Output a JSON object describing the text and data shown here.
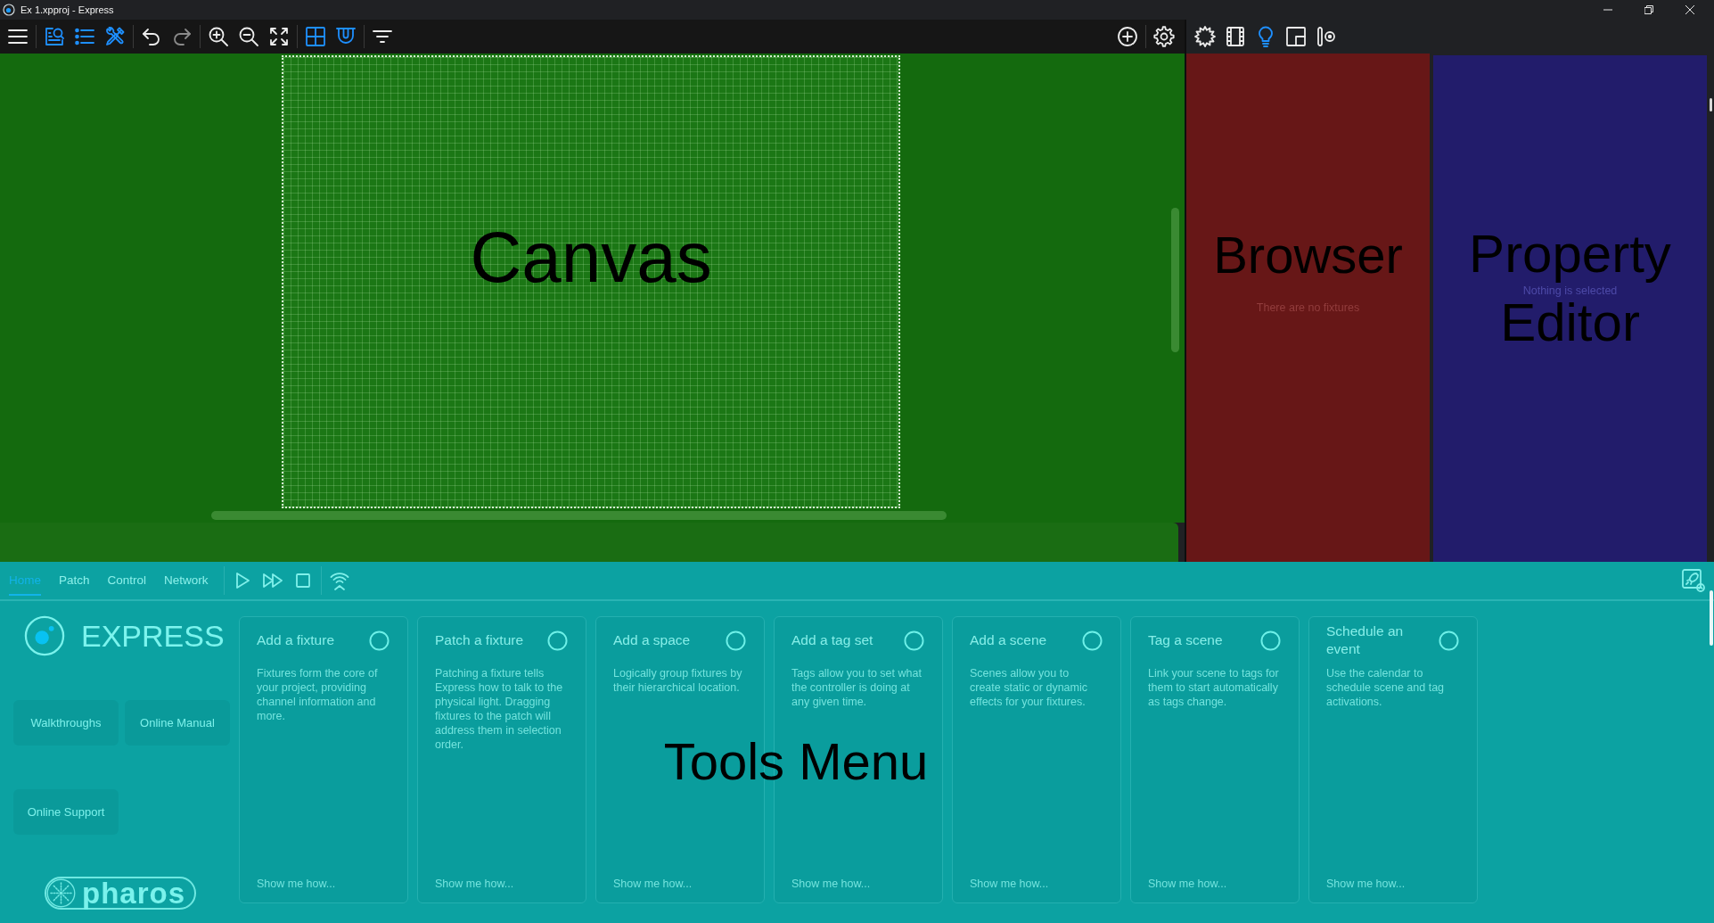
{
  "window": {
    "title": "Ex 1.xpproj - Express"
  },
  "toolbar": {
    "left": [
      [
        {
          "kind": "menu",
          "on": false,
          "disabled": false
        }
      ],
      [
        {
          "kind": "browse",
          "on": true,
          "disabled": false
        },
        {
          "kind": "list",
          "on": true,
          "disabled": false
        },
        {
          "kind": "tools",
          "on": true,
          "disabled": false
        }
      ],
      [
        {
          "kind": "undo",
          "on": false,
          "disabled": false
        },
        {
          "kind": "redo",
          "on": false,
          "disabled": true
        }
      ],
      [
        {
          "kind": "zoomin",
          "on": false,
          "disabled": false
        },
        {
          "kind": "zoomout",
          "on": false,
          "disabled": false
        },
        {
          "kind": "fit",
          "on": false,
          "disabled": false
        }
      ],
      [
        {
          "kind": "grid",
          "on": true,
          "disabled": false
        },
        {
          "kind": "snap",
          "on": true,
          "disabled": false
        }
      ],
      [
        {
          "kind": "filter",
          "on": false,
          "disabled": false
        }
      ]
    ],
    "right": [
      [
        {
          "kind": "add",
          "on": false,
          "disabled": false
        }
      ],
      [
        {
          "kind": "settings",
          "on": false,
          "disabled": false
        }
      ]
    ]
  },
  "canvas": {
    "title": "Canvas"
  },
  "browser": {
    "toolbar": [
      {
        "kind": "effects",
        "on": false
      },
      {
        "kind": "timeline",
        "on": false
      },
      {
        "kind": "light",
        "on": true
      },
      {
        "kind": "layout",
        "on": false
      },
      {
        "kind": "control",
        "on": false
      }
    ],
    "title": "Browser",
    "empty_message": "There are no fixtures"
  },
  "property_editor": {
    "title_lines": [
      "Property",
      "Editor"
    ],
    "empty_message": "Nothing is selected"
  },
  "tools_menu": {
    "title": "Tools Menu",
    "tabs": [
      {
        "label": "Home",
        "selected": true
      },
      {
        "label": "Patch",
        "selected": false
      },
      {
        "label": "Control",
        "selected": false
      },
      {
        "label": "Network",
        "selected": false
      }
    ],
    "brand": "EXPRESS",
    "links": [
      "Walkthroughs",
      "Online Manual",
      "Online Support"
    ],
    "company_logo": "pharos",
    "cards": [
      {
        "title": "Add a fixture",
        "description": "Fixtures form the core of your project, providing channel information and more.",
        "link": "Show me how...",
        "completed": false
      },
      {
        "title": "Patch a fixture",
        "description": "Patching a fixture tells Express how to talk to the physical light. Dragging fixtures to the patch will address them in selection order.",
        "link": "Show me how...",
        "completed": false
      },
      {
        "title": "Add a space",
        "description": "Logically group fixtures by their hierarchical location.",
        "link": "Show me how...",
        "completed": false
      },
      {
        "title": "Add a tag set",
        "description": "Tags allow you to set what the controller is doing at any given time.",
        "link": "Show me how...",
        "completed": false
      },
      {
        "title": "Add a scene",
        "description": "Scenes allow you to create static or dynamic effects for your fixtures.",
        "link": "Show me how...",
        "completed": false
      },
      {
        "title": "Tag a scene",
        "description": "Link your scene to tags for them to start automatically as tags change.",
        "link": "Show me how...",
        "completed": false
      },
      {
        "title": "Schedule an event",
        "description": "Use the calendar to schedule scene and tag activations.",
        "link": "Show me how...",
        "completed": false
      }
    ]
  }
}
